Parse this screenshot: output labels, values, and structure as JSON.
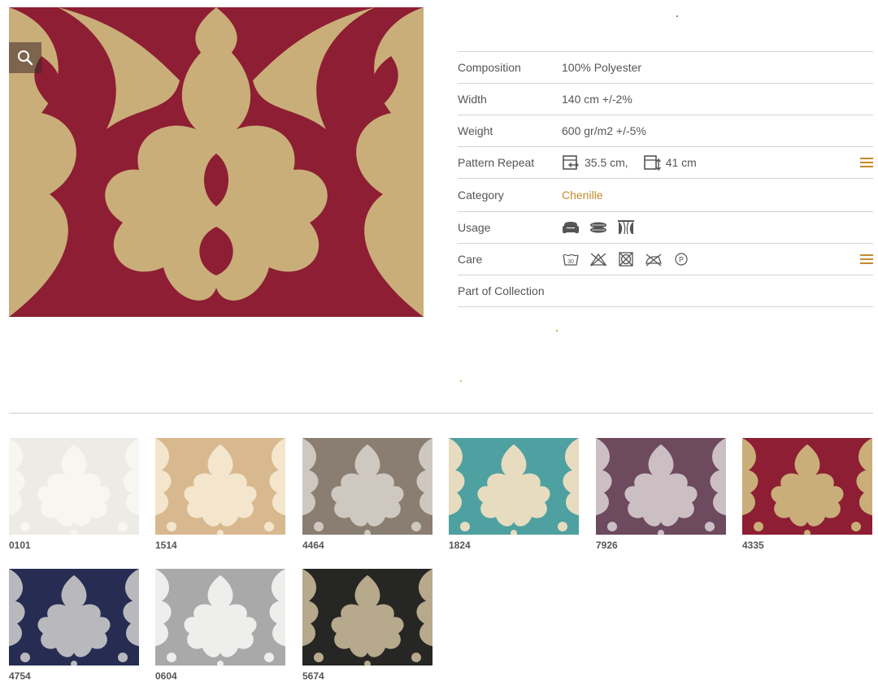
{
  "product": {
    "image_alt_colors": {
      "ground": "#8e1e33",
      "pattern": "#c9ae7a"
    }
  },
  "specs": {
    "composition": {
      "label": "Composition",
      "value": "100% Polyester"
    },
    "width": {
      "label": "Width",
      "value": "140 cm +/-2%"
    },
    "weight": {
      "label": "Weight",
      "value": "600 gr/m2 +/-5%"
    },
    "pattern_repeat": {
      "label": "Pattern Repeat",
      "horizontal": "35.5 cm,",
      "vertical": "41 cm"
    },
    "category": {
      "label": "Category",
      "value": "Chenille"
    },
    "usage": {
      "label": "Usage",
      "icons": [
        "armchair-icon",
        "cushion-icon",
        "curtain-icon"
      ]
    },
    "care": {
      "label": "Care",
      "icons": [
        "wash-30-icon",
        "no-bleach-icon",
        "no-tumble-dry-icon",
        "no-iron-icon",
        "dry-clean-p-icon"
      ]
    },
    "collection": {
      "label": "Part of Collection",
      "value": ""
    }
  },
  "colors": {
    "accent": "#c48a2a",
    "rule": "#d4d4d4"
  },
  "swatches": [
    {
      "code": "0101",
      "ground": "#ecebe5",
      "pattern": "#f7f6f1"
    },
    {
      "code": "1514",
      "ground": "#d8b98f",
      "pattern": "#f3e6cc"
    },
    {
      "code": "4464",
      "ground": "#8a7d72",
      "pattern": "#cfc8c0"
    },
    {
      "code": "1824",
      "ground": "#4fa0a0",
      "pattern": "#e7dcc0"
    },
    {
      "code": "7926",
      "ground": "#6e4a5e",
      "pattern": "#cbbfc4"
    },
    {
      "code": "4335",
      "ground": "#8e1e33",
      "pattern": "#c9ae7a"
    },
    {
      "code": "4754",
      "ground": "#262c52",
      "pattern": "#b9b9bd"
    },
    {
      "code": "0604",
      "ground": "#a9a9aa",
      "pattern": "#eeeeec"
    },
    {
      "code": "5674",
      "ground": "#262624",
      "pattern": "#b6a98c"
    }
  ]
}
